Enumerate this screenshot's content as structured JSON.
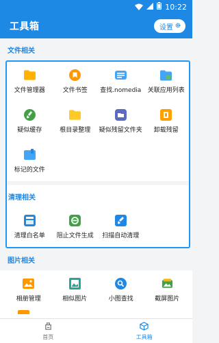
{
  "status_bar": {
    "time": "10:22"
  },
  "app_bar": {
    "title": "工具箱",
    "settings_label": "设置"
  },
  "sections": [
    {
      "title": "文件相关",
      "items": [
        {
          "label": "文件管理器",
          "icon": "folder-icon",
          "color": "#ffb300"
        },
        {
          "label": "文件书签",
          "icon": "bookmark-icon",
          "color": "#ff9800"
        },
        {
          "label": "查找.nomedia",
          "icon": "search-file-icon",
          "color": "#42a5f5"
        },
        {
          "label": "关联应用列表",
          "icon": "app-folder-icon",
          "color": "#42a5f5"
        },
        {
          "label": "疑似缓存",
          "icon": "clean-brush-icon",
          "color": "#43a047"
        },
        {
          "label": "根目录整理",
          "icon": "root-folder-icon",
          "color": "#ffca28"
        },
        {
          "label": "疑似残留文件夹",
          "icon": "residual-folder-icon",
          "color": "#5c6bc0"
        },
        {
          "label": "卸载残留",
          "icon": "uninstall-residue-icon",
          "color": "#ffa000"
        },
        {
          "label": "标记的文件",
          "icon": "marked-file-icon",
          "color": "#42a5f5"
        }
      ]
    },
    {
      "title": "清理相关",
      "items": [
        {
          "label": "清理白名单",
          "icon": "whitelist-icon",
          "color": "#1e88e5"
        },
        {
          "label": "阻止文件生成",
          "icon": "block-file-icon",
          "color": "#43a047"
        },
        {
          "label": "扫描自动清理",
          "icon": "auto-clean-icon",
          "color": "#1e88e5"
        }
      ]
    },
    {
      "title": "图片相关",
      "items": [
        {
          "label": "相册管理",
          "icon": "album-icon",
          "color": "#ff9800"
        },
        {
          "label": "相似图片",
          "icon": "similar-image-icon",
          "color": "#26a69a"
        },
        {
          "label": "小图查找",
          "icon": "small-image-search-icon",
          "color": "#1e88e5"
        },
        {
          "label": "截屏图片",
          "icon": "screenshot-icon",
          "color": "#43a047"
        }
      ]
    }
  ],
  "bottom_nav": [
    {
      "label": "首页",
      "icon": "home-icon",
      "active": false
    },
    {
      "label": "工具箱",
      "icon": "toolbox-icon",
      "active": true
    }
  ]
}
